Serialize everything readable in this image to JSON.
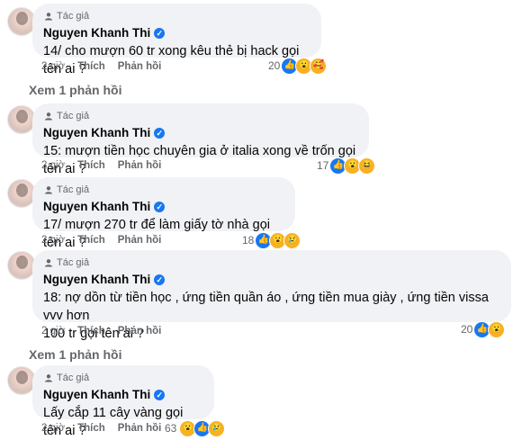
{
  "comments": [
    {
      "author_tag": "Tác giả",
      "name": "Nguyen Khanh Thi",
      "text": "14/ cho mượn 60 tr xong kêu thẻ bị hack gọi tên ai ?",
      "time": "2 giờ",
      "like_label": "Thích",
      "reply_label": "Phản hồi",
      "reaction_count": "20",
      "reactions": [
        "like-icon",
        "wow-icon",
        "care-icon"
      ],
      "view_replies": "Xem 1 phản hồi"
    },
    {
      "author_tag": "Tác giả",
      "name": "Nguyen Khanh Thi",
      "text": "15: mượn tiền học chuyên gia ở italia xong về trốn gọi tên ai ?",
      "time": "2 giờ",
      "like_label": "Thích",
      "reply_label": "Phản hồi",
      "reaction_count": "17",
      "reactions": [
        "like-icon",
        "wow-icon",
        "haha-icon"
      ]
    },
    {
      "author_tag": "Tác giả",
      "name": "Nguyen Khanh Thi",
      "text": "17/ mượn 270 tr để làm giấy tờ nhà gọi tên ai ?",
      "time": "2 giờ",
      "like_label": "Thích",
      "reply_label": "Phản hồi",
      "reaction_count": "18",
      "reactions": [
        "like-icon",
        "wow-icon",
        "sad-icon"
      ]
    },
    {
      "author_tag": "Tác giả",
      "name": "Nguyen Khanh Thi",
      "text_line1": "18: nợ dồn từ tiền học , ứng tiền quần áo , ứng tiền mua giày , ứng tiền vissa vvv hơn",
      "text_line2": "100 tr gọi tên ai ?",
      "time": "2 giờ",
      "like_label": "Thích",
      "reply_label": "Phản hồi",
      "reaction_count": "20",
      "reactions": [
        "like-icon",
        "wow-icon"
      ],
      "view_replies": "Xem 1 phản hồi"
    },
    {
      "author_tag": "Tác giả",
      "name": "Nguyen Khanh Thi",
      "text": "Lấy cắp 11 cây vàng gọi tên ai ?",
      "time": "2 giờ",
      "like_label": "Thích",
      "reply_label": "Phản hồi",
      "reaction_count": "63",
      "reactions": [
        "wow-icon",
        "like-icon",
        "sad-icon"
      ]
    }
  ],
  "colors": {
    "bubble": "#f0f2f5",
    "verified": "#1877f2",
    "meta": "#65676b"
  }
}
